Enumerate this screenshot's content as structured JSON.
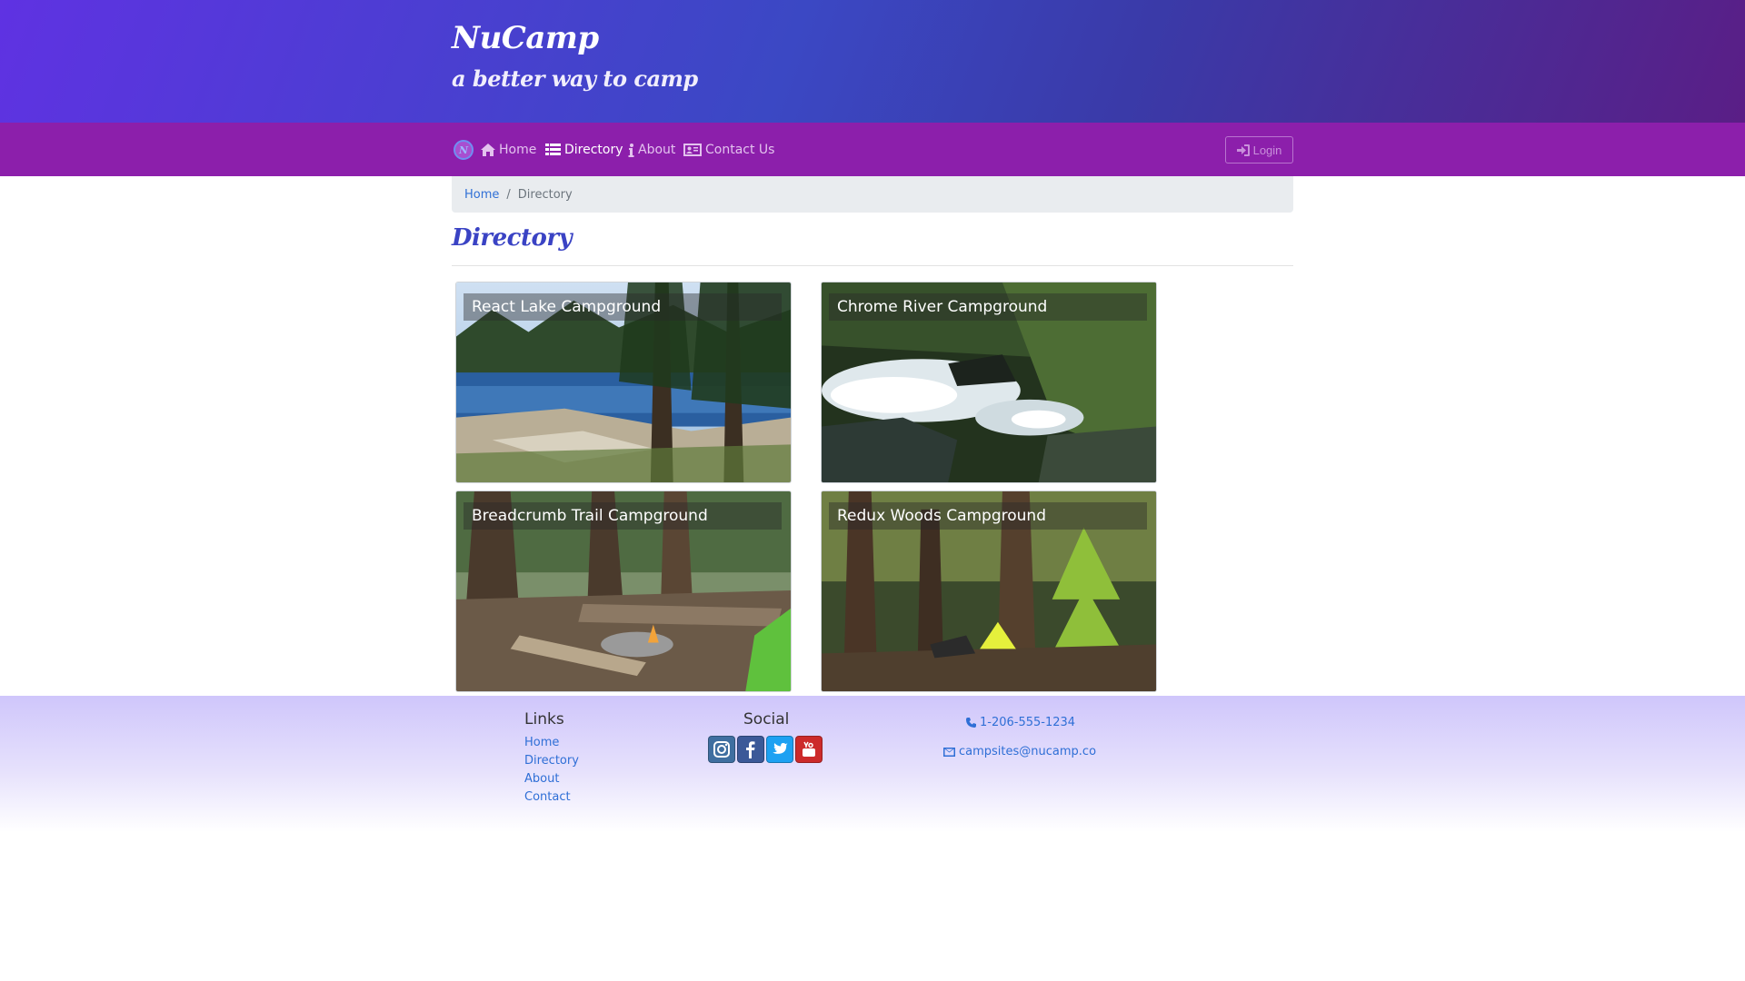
{
  "header": {
    "brand": "NuCamp",
    "tagline": "a better way to camp"
  },
  "nav": {
    "items": [
      {
        "label": "Home",
        "icon": "home-icon",
        "active": false
      },
      {
        "label": "Directory",
        "icon": "list-icon",
        "active": true
      },
      {
        "label": "About",
        "icon": "info-icon",
        "active": false
      },
      {
        "label": "Contact Us",
        "icon": "address-card-icon",
        "active": false
      }
    ],
    "login_label": "Login"
  },
  "breadcrumb": {
    "home": "Home",
    "current": "Directory"
  },
  "page": {
    "title": "Directory"
  },
  "campsites": [
    {
      "name": "React Lake Campground"
    },
    {
      "name": "Chrome River Campground"
    },
    {
      "name": "Breadcrumb Trail Campground"
    },
    {
      "name": "Redux Woods Campground"
    }
  ],
  "footer": {
    "links_heading": "Links",
    "links": [
      "Home",
      "Directory",
      "About",
      "Contact"
    ],
    "social_heading": "Social",
    "social": [
      "instagram-icon",
      "facebook-icon",
      "twitter-icon",
      "youtube-icon"
    ],
    "phone": "1-206-555-1234",
    "email": "campsites@nucamp.co"
  },
  "colors": {
    "header_start": "#5f32e2",
    "header_end": "#5a1e86",
    "navbar": "#8c1fab",
    "title": "#3a43c4",
    "link": "#2f6fd6"
  }
}
